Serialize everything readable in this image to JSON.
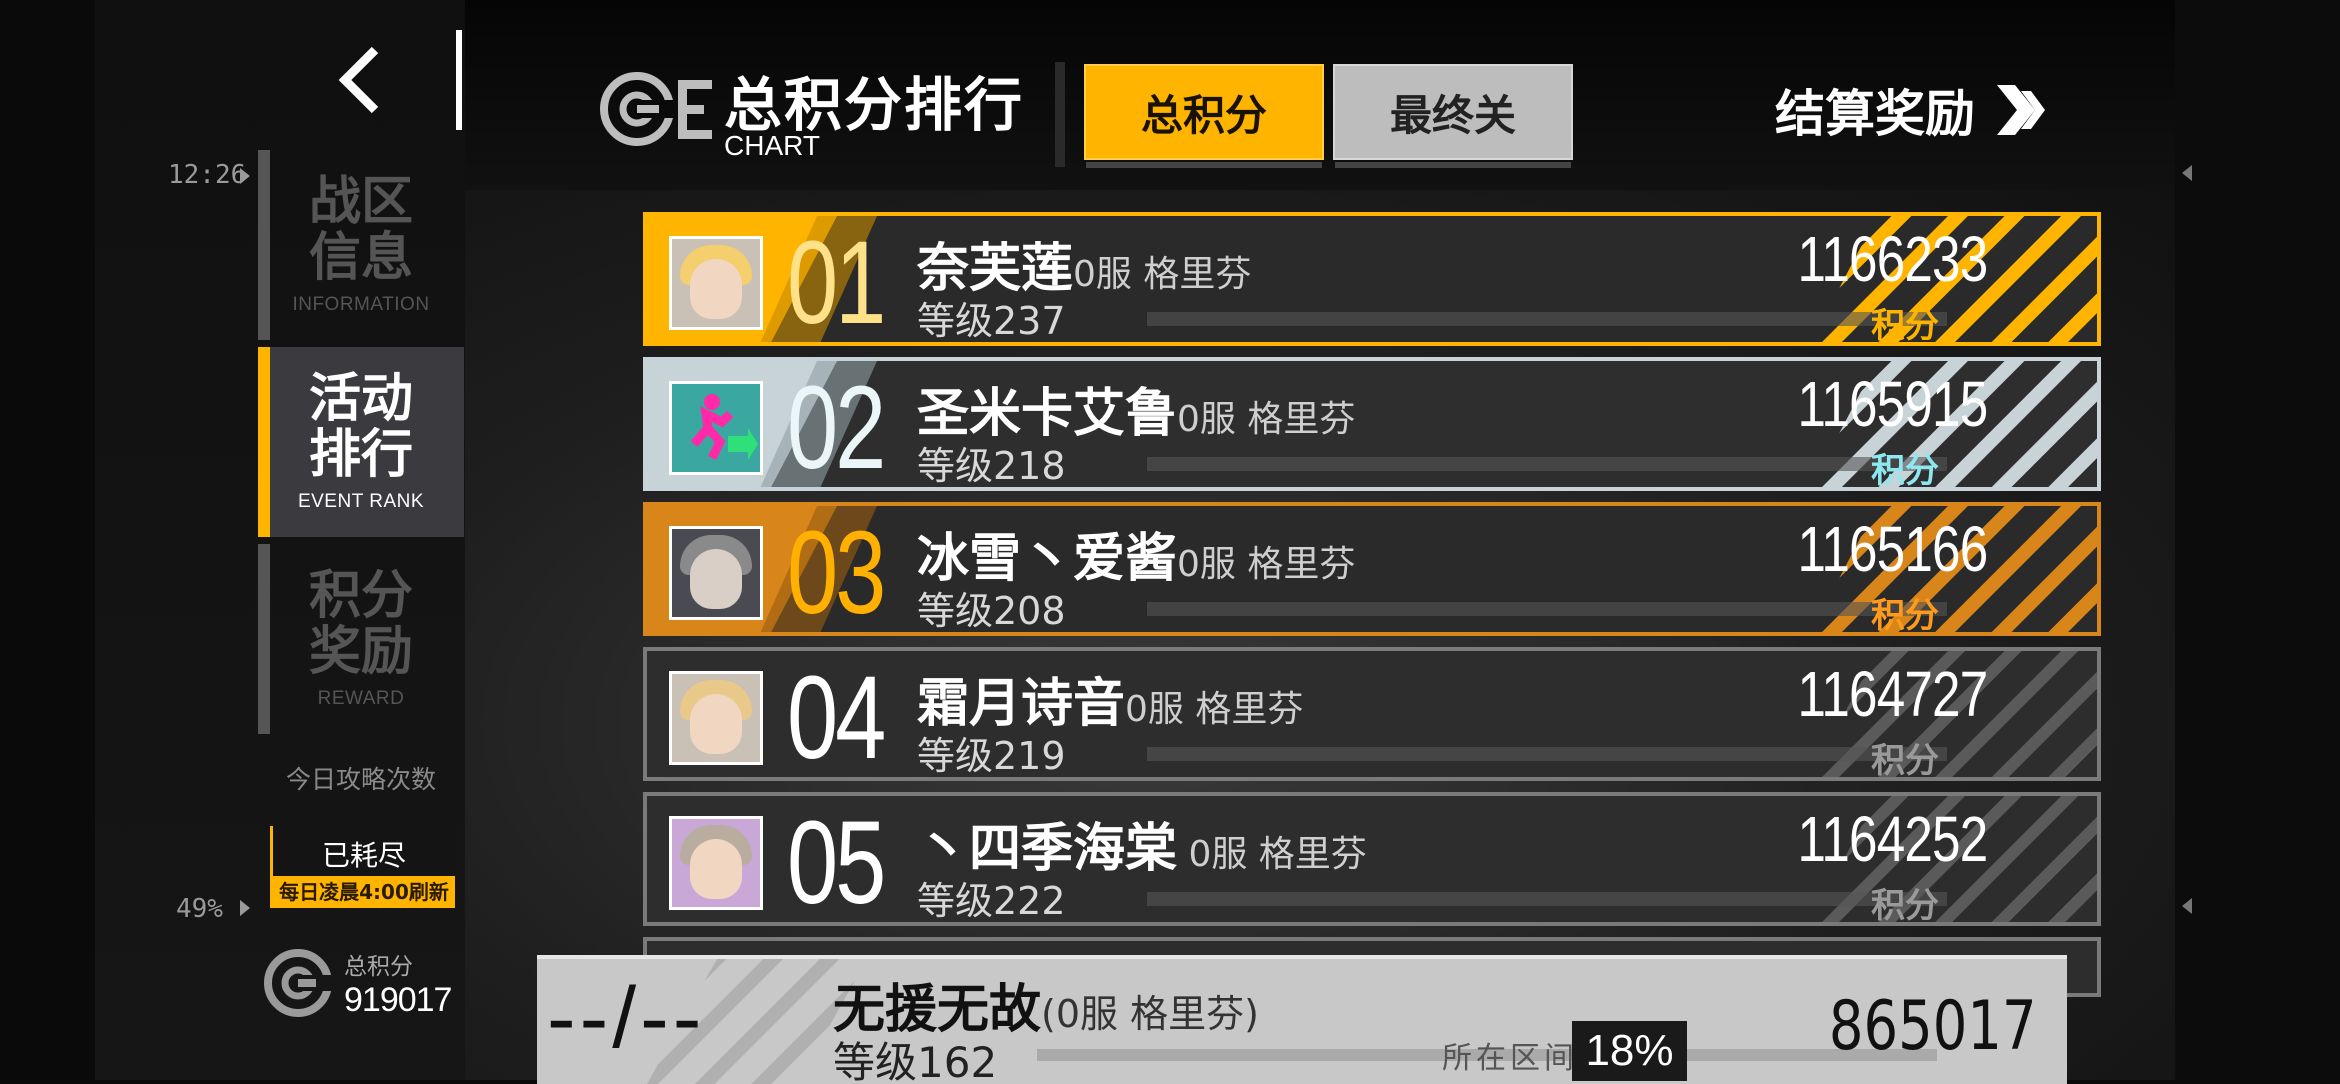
{
  "nav": {
    "back_label": "<",
    "items": [
      {
        "zh": "战区\n信息",
        "en": "INFORMATION"
      },
      {
        "zh": "活动\n排行",
        "en": "EVENT RANK"
      },
      {
        "zh": "积分\n奖励",
        "en": "REWARD"
      }
    ],
    "attempts_label": "今日攻略次数",
    "attempts_value": "已耗尽",
    "refresh_note": "每日凌晨4:00刷新",
    "total_label": "总积分",
    "total_value": "919017"
  },
  "edge": {
    "time": "12:26",
    "battery": "49%"
  },
  "header": {
    "title_zh": "总积分排行",
    "title_en": "CHART",
    "tabs": [
      {
        "label": "总积分",
        "active": true
      },
      {
        "label": "最终关",
        "active": false
      }
    ],
    "reward_button": "结算奖励"
  },
  "rankings": [
    {
      "rank": "01",
      "name": "奈芙莲",
      "server": "0服  格里芬",
      "level": "等级237",
      "score": "1166233",
      "score_label": "积分",
      "tier": "gold",
      "label_color": "#ffb400"
    },
    {
      "rank": "02",
      "name": "圣米卡艾鲁",
      "server": "0服  格里芬",
      "level": "等级218",
      "score": "1165915",
      "score_label": "积分",
      "tier": "silver",
      "label_color": "#8ee8f0"
    },
    {
      "rank": "03",
      "name": "冰雪丶爱酱",
      "server": "0服  格里芬",
      "level": "等级208",
      "score": "1165166",
      "score_label": "积分",
      "tier": "bronze",
      "label_color": "#ff9a1a"
    },
    {
      "rank": "04",
      "name": "霜月诗音",
      "server": "0服  格里芬",
      "level": "等级219",
      "score": "1164727",
      "score_label": "积分",
      "tier": "plain",
      "label_color": "#9a9a9a"
    },
    {
      "rank": "05",
      "name": "丶四季海棠",
      "server": " 0服  格里芬",
      "level": "等级222",
      "score": "1164252",
      "score_label": "积分",
      "tier": "plain",
      "label_color": "#9a9a9a"
    }
  ],
  "self": {
    "rank": "--/--",
    "name": "无援无故",
    "server": "(0服  格里芬)",
    "level": "等级162",
    "score": "865017",
    "interval_label": "所在区间",
    "percentile": "18%"
  },
  "colors": {
    "accent": "#ffb400",
    "silver": "#c7d3d7",
    "bronze": "#d8861a"
  }
}
